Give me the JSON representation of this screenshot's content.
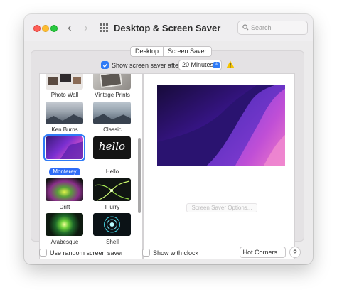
{
  "window": {
    "title": "Desktop & Screen Saver",
    "search_placeholder": "Search"
  },
  "tabs": [
    "Desktop",
    "Screen Saver"
  ],
  "show_screen_saver": {
    "label": "Show screen saver after",
    "checked": true
  },
  "delay_select": {
    "value": "20 Minutes"
  },
  "screensavers": [
    {
      "name": "Photo Wall",
      "selected": false
    },
    {
      "name": "Vintage Prints",
      "selected": false
    },
    {
      "name": "Ken Burns",
      "selected": false
    },
    {
      "name": "Classic",
      "selected": false
    },
    {
      "name": "Monterey",
      "selected": true
    },
    {
      "name": "Hello",
      "selected": false
    },
    {
      "name": "Drift",
      "selected": false
    },
    {
      "name": "Flurry",
      "selected": false
    },
    {
      "name": "Arabesque",
      "selected": false
    },
    {
      "name": "Shell",
      "selected": false
    }
  ],
  "hello_thumb_text": "hello",
  "preview": {
    "options_button": "Screen Saver Options..."
  },
  "footer": {
    "random_label": "Use random screen saver",
    "clock_label": "Show with clock",
    "hot_corners": "Hot Corners...",
    "help": "?"
  },
  "colors": {
    "accent": "#2f7bf6",
    "warning": "#f5c400"
  }
}
